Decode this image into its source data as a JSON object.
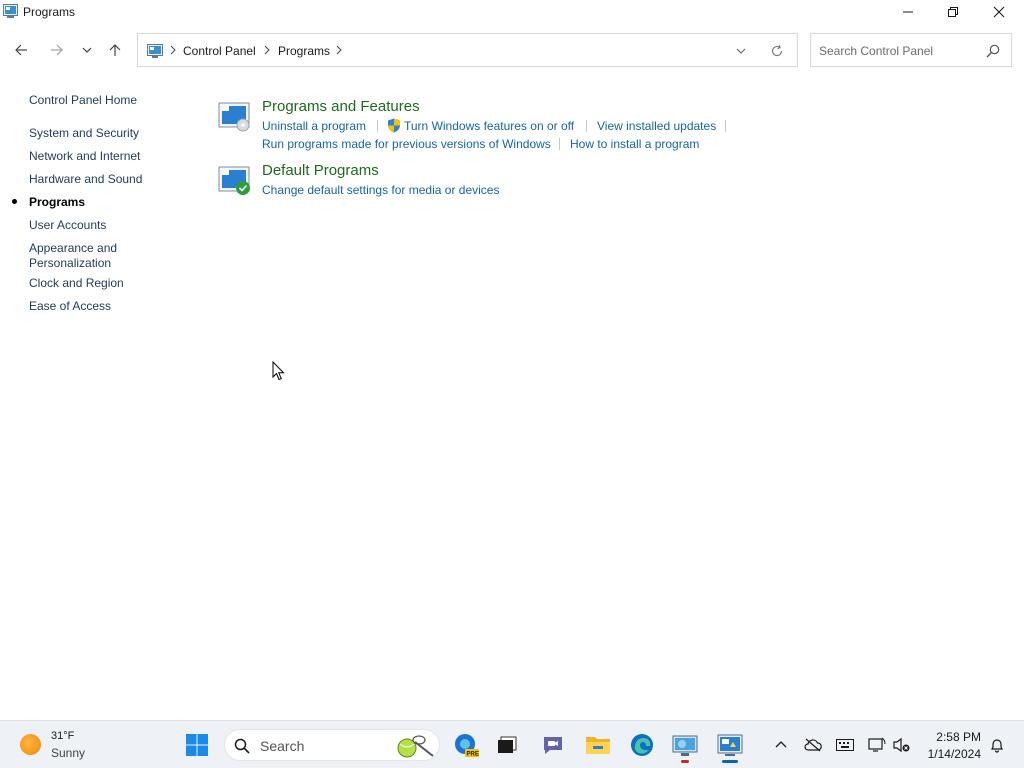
{
  "window": {
    "title": "Programs",
    "minimize_icon": "minimize-icon",
    "maximize_icon": "restore-icon",
    "close_icon": "close-icon"
  },
  "nav": {
    "back_icon": "arrow-left-icon",
    "forward_icon": "arrow-right-icon",
    "recent_icon": "chevron-down-icon",
    "up_icon": "arrow-up-icon",
    "breadcrumb": [
      "Control Panel",
      "Programs"
    ],
    "refresh_icon": "refresh-icon",
    "search_placeholder": "Search Control Panel"
  },
  "sidebar": {
    "home": "Control Panel Home",
    "items": [
      {
        "label": "System and Security",
        "current": false
      },
      {
        "label": "Network and Internet",
        "current": false
      },
      {
        "label": "Hardware and Sound",
        "current": false
      },
      {
        "label": "Programs",
        "current": true
      },
      {
        "label": "User Accounts",
        "current": false
      },
      {
        "label": "Appearance and",
        "label2": "Personalization",
        "current": false
      },
      {
        "label": "Clock and Region",
        "current": false
      },
      {
        "label": "Ease of Access",
        "current": false
      }
    ]
  },
  "content": {
    "programs_features": {
      "title": "Programs and Features",
      "links": [
        "Uninstall a program",
        "Turn Windows features on or off",
        "View installed updates",
        "Run programs made for previous versions of Windows",
        "How to install a program"
      ]
    },
    "default_programs": {
      "title": "Default Programs",
      "links": [
        "Change default settings for media or devices"
      ]
    }
  },
  "taskbar": {
    "weather_temp": "31°F",
    "weather_cond": "Sunny",
    "search_label": "Search",
    "time": "2:58 PM",
    "date": "1/14/2024"
  },
  "colors": {
    "link": "#1565a8",
    "section_title": "#1e6b1e",
    "accent": "#0067c0"
  }
}
